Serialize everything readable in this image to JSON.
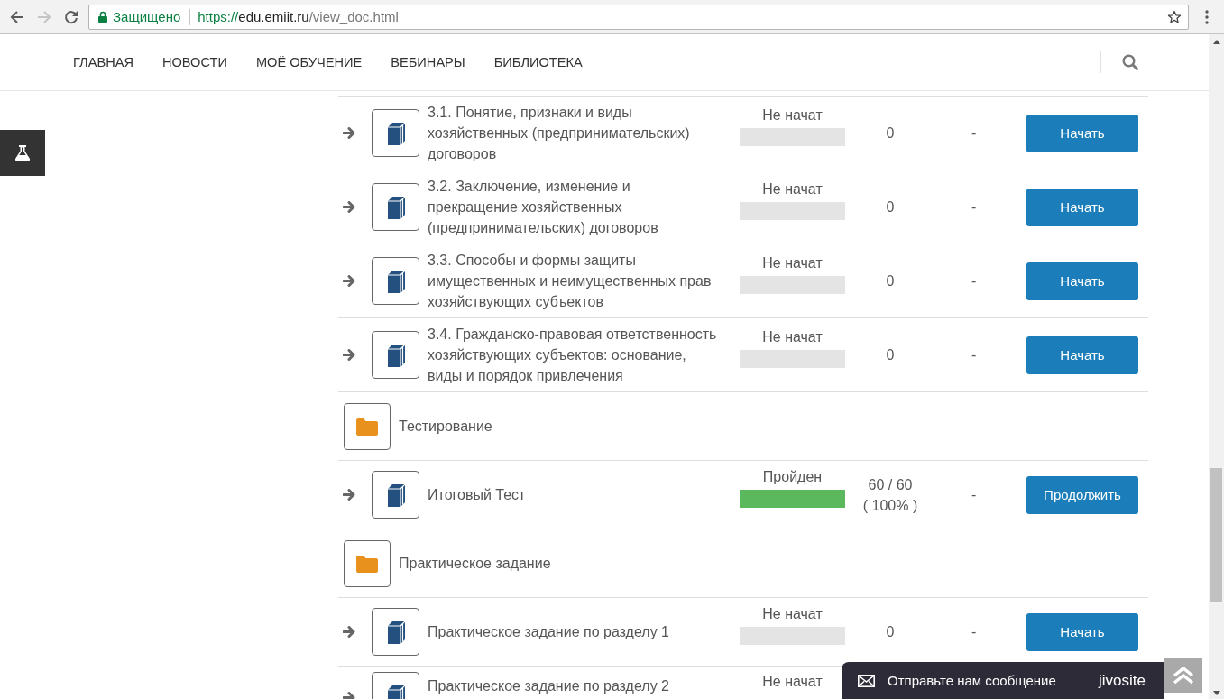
{
  "browser": {
    "nav_buttons": [
      {
        "kind": "back",
        "disabled": false
      },
      {
        "kind": "forward",
        "disabled": true
      },
      {
        "kind": "reload",
        "disabled": false
      }
    ],
    "security_label": "Защищено",
    "url": [
      {
        "kind": "scheme",
        "text": "https://"
      },
      {
        "kind": "host",
        "text": "edu.emiit.ru"
      },
      {
        "kind": "path",
        "text": "/view_doc.html"
      }
    ]
  },
  "nav": {
    "items": [
      {
        "label": "ГЛАВНАЯ"
      },
      {
        "label": "НОВОСТИ"
      },
      {
        "label": "МОЁ ОБУЧЕНИЕ"
      },
      {
        "label": "ВЕБИНАРЫ"
      },
      {
        "label": "БИБЛИОТЕКА"
      }
    ]
  },
  "rows": [
    {
      "kind": "item",
      "title": "3.1. Понятие, признаки и виды\nхозяйственных (предпринимательских)\nдоговоров",
      "status": "Не начат",
      "level": 0,
      "score": "0",
      "deadline": "-",
      "button": "Начать"
    },
    {
      "kind": "item",
      "title": "3.2. Заключение, изменение и\nпрекращение хозяйственных\n(предпринимательских) договоров",
      "status": "Не начат",
      "level": 0,
      "score": "0",
      "deadline": "-",
      "button": "Начать"
    },
    {
      "kind": "item",
      "title": "3.3. Способы и формы защиты\nимущественных и неимущественных прав\nхозяйствующих субъектов",
      "status": "Не начат",
      "level": 0,
      "score": "0",
      "deadline": "-",
      "button": "Начать"
    },
    {
      "kind": "item",
      "title": "3.4. Гражданско-правовая ответственность\nхозяйствующих субъектов: основание,\nвиды и порядок привлечения",
      "status": "Не начат",
      "level": 0,
      "score": "0",
      "deadline": "-",
      "button": "Начать"
    },
    {
      "kind": "section",
      "title": "Тестирование"
    },
    {
      "kind": "item",
      "title": "Итоговый Тест",
      "status": "Пройден",
      "level": 1,
      "score": "60 / 60",
      "percent": "( 100% )",
      "deadline": "-",
      "button": "Продолжить"
    },
    {
      "kind": "section",
      "title": "Практическое задание"
    },
    {
      "kind": "item",
      "title": "Практическое задание по разделу 1",
      "status": "Не начат",
      "level": 0,
      "score": "0",
      "deadline": "-",
      "button": "Начать"
    },
    {
      "kind": "item",
      "title": "Практическое задание по разделу 2",
      "status": "Не начат"
    }
  ],
  "chat_widget": {
    "message": "Отправьте нам сообщение",
    "brand": "jivosite"
  }
}
